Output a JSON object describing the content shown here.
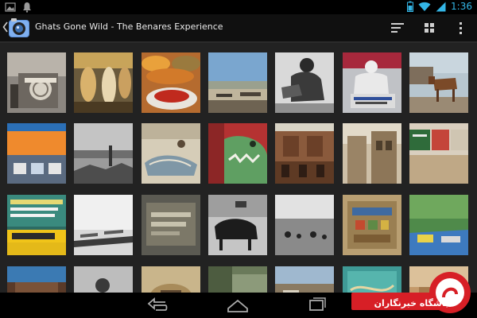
{
  "status_bar": {
    "time": "1:36",
    "icons": [
      "gallery-icon",
      "notification-icon",
      "battery-icon",
      "wifi-icon",
      "signal-icon"
    ]
  },
  "action_bar": {
    "title": "Ghats Gone Wild - The Benares Experience",
    "actions": [
      "sort-icon",
      "grid-view-icon",
      "overflow-menu-icon"
    ]
  },
  "nav_bar": {
    "buttons": [
      "back-icon",
      "home-icon",
      "recent-apps-icon"
    ]
  },
  "watermark": {
    "text": "باشگاه خبرنگاران"
  },
  "grid": {
    "columns": 7,
    "rows": 4,
    "items": [
      {
        "kind": "sign-temple"
      },
      {
        "kind": "statues"
      },
      {
        "kind": "spices"
      },
      {
        "kind": "river-ghats"
      },
      {
        "kind": "man-bw"
      },
      {
        "kind": "sadhu-statue"
      },
      {
        "kind": "cow-street"
      },
      {
        "kind": "orange-wall"
      },
      {
        "kind": "boats-bw"
      },
      {
        "kind": "boat-whale"
      },
      {
        "kind": "crocodile-mural"
      },
      {
        "kind": "palace"
      },
      {
        "kind": "old-building"
      },
      {
        "kind": "painted-signs"
      },
      {
        "kind": "shiva-cafe"
      },
      {
        "kind": "boats-mist"
      },
      {
        "kind": "association-sign"
      },
      {
        "kind": "buffalo"
      },
      {
        "kind": "river-people"
      },
      {
        "kind": "mural-wall"
      },
      {
        "kind": "green-mural"
      },
      {
        "kind": "row4-a"
      },
      {
        "kind": "row4-b"
      },
      {
        "kind": "row4-c"
      },
      {
        "kind": "row4-d"
      },
      {
        "kind": "row4-e"
      },
      {
        "kind": "row4-f"
      },
      {
        "kind": "row4-g"
      }
    ]
  },
  "colors": {
    "accent": "#33b5e5",
    "action_bar_bg": "#101010",
    "grid_bg": "#222222",
    "watermark_red": "#d71f26"
  }
}
